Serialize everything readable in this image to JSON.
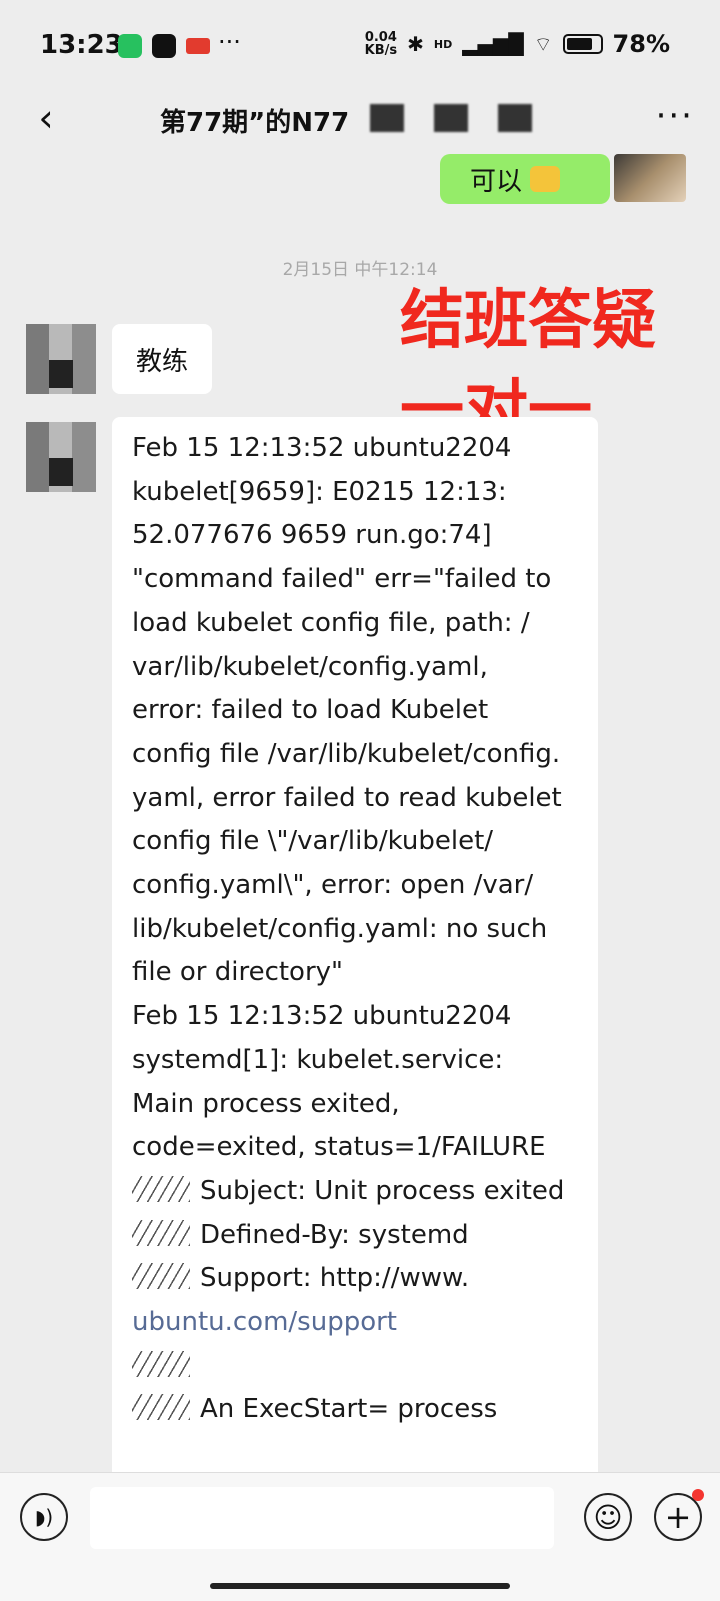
{
  "status_bar": {
    "time": "13:23",
    "speed_value": "0.04",
    "speed_unit": "KB/s",
    "network_label": "HD",
    "battery": "78%",
    "overflow": "···"
  },
  "header": {
    "title": "第77期”的N77",
    "back_glyph": "‹",
    "menu_glyph": "···"
  },
  "messages": {
    "sent_text": "可以",
    "timestamp": "2月15日 中午12:14",
    "received_short": "教练",
    "overlay_line1": "结班答疑",
    "overlay_line2": "一对一",
    "log_lines": [
      "Feb 15 12:13:52 ubuntu2204",
      "kubelet[9659]: E0215 12:13:",
      "52.077676    9659 run.go:74]",
      "\"command failed\" err=\"failed to",
      "load kubelet config file, path: /",
      "var/lib/kubelet/config.yaml,",
      "error: failed to load Kubelet",
      "config file /var/lib/kubelet/config.",
      "yaml, error failed to read kubelet",
      "config file \\\"/var/lib/kubelet/",
      "config.yaml\\\", error: open /var/",
      "lib/kubelet/config.yaml: no such",
      "file or directory\"",
      "Feb 15 12:13:52 ubuntu2204",
      "systemd[1]: kubelet.service:",
      "Main process exited,",
      "code=exited, status=1/FAILURE",
      "Subject: Unit process exited",
      "Defined-By: systemd",
      "Support: http://www.",
      "ubuntu.com/support",
      "",
      "An ExecStart= process"
    ]
  },
  "input": {
    "placeholder": ""
  },
  "colors": {
    "background": "#ededed",
    "sent_bubble": "#95ec69",
    "overlay_red": "#f0281e",
    "link": "#576b95"
  }
}
